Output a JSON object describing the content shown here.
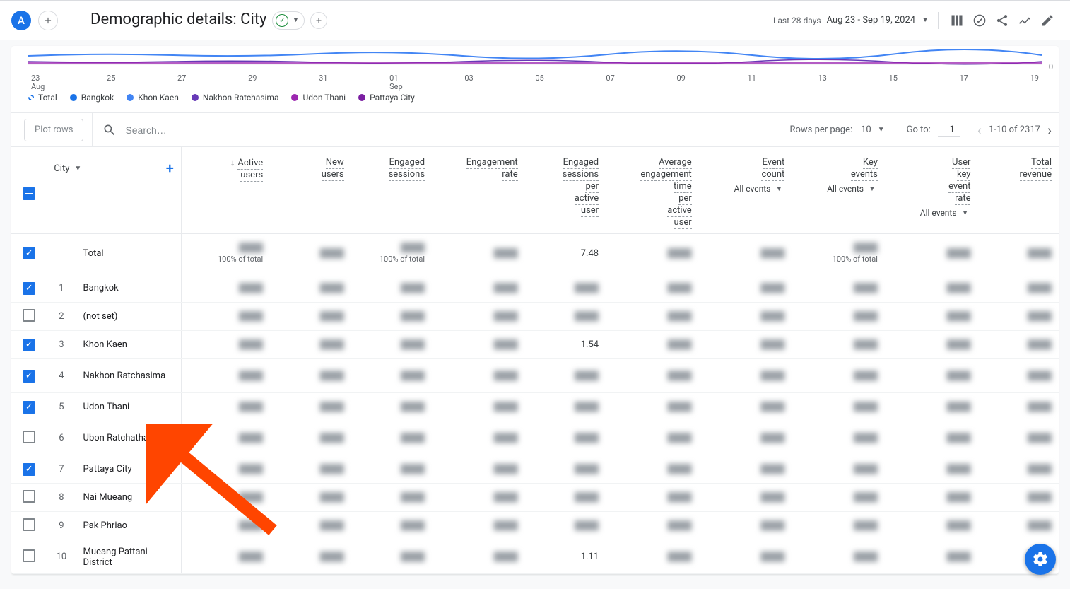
{
  "avatar_letter": "A",
  "page_title": "Demographic details: City",
  "date_label": "Last 28 days",
  "date_range": "Aug 23 - Sep 19, 2024",
  "chart": {
    "y_zero": "0",
    "x_ticks": [
      "23\nAug",
      "25",
      "27",
      "29",
      "31",
      "01\nSep",
      "03",
      "05",
      "07",
      "09",
      "11",
      "13",
      "15",
      "17",
      "19"
    ]
  },
  "legend": [
    {
      "label": "Total",
      "color": "hollow"
    },
    {
      "label": "Bangkok",
      "color": "#1a73e8"
    },
    {
      "label": "Khon Kaen",
      "color": "#4285f4"
    },
    {
      "label": "Nakhon Ratchasima",
      "color": "#673ab7"
    },
    {
      "label": "Udon Thani",
      "color": "#9c27b0"
    },
    {
      "label": "Pattaya City",
      "color": "#7b1fa2"
    }
  ],
  "controls": {
    "plot_rows": "Plot rows",
    "search_placeholder": "Search…",
    "rows_per_page_label": "Rows per page:",
    "rows_per_page_value": "10",
    "go_to_label": "Go to:",
    "go_to_value": "1",
    "range_text": "1-10 of 2317"
  },
  "columns": {
    "dim_label": "City",
    "metrics": [
      {
        "label": "Active users",
        "sort": true
      },
      {
        "label": "New users"
      },
      {
        "label": "Engaged sessions"
      },
      {
        "label": "Engagement rate"
      },
      {
        "label": "Engaged sessions per active user"
      },
      {
        "label": "Average engagement time per active user"
      },
      {
        "label": "Event count",
        "sub": "All events"
      },
      {
        "label": "Key events",
        "sub": "All events"
      },
      {
        "label": "User key event rate",
        "sub": "All events"
      },
      {
        "label": "Total revenue"
      }
    ]
  },
  "total_row": {
    "label": "Total",
    "subs": [
      "100% of total",
      "",
      "100% of total",
      "",
      "",
      "",
      "",
      "100% of total",
      "",
      ""
    ],
    "clear_vals": [
      "",
      "",
      "",
      "",
      "7.48",
      "",
      "",
      "",
      "",
      ""
    ]
  },
  "rows": [
    {
      "rank": "1",
      "name": "Bangkok",
      "checked": true,
      "clear": {}
    },
    {
      "rank": "2",
      "name": "(not set)",
      "checked": false,
      "clear": {}
    },
    {
      "rank": "3",
      "name": "Khon Kaen",
      "checked": true,
      "clear": {
        "4": "1.54"
      }
    },
    {
      "rank": "4",
      "name": "Nakhon Ratchasima",
      "checked": true,
      "clear": {}
    },
    {
      "rank": "5",
      "name": "Udon Thani",
      "checked": true,
      "clear": {}
    },
    {
      "rank": "6",
      "name": "Ubon Ratchathani",
      "checked": false,
      "clear": {}
    },
    {
      "rank": "7",
      "name": "Pattaya City",
      "checked": true,
      "clear": {}
    },
    {
      "rank": "8",
      "name": "Nai Mueang",
      "checked": false,
      "clear": {}
    },
    {
      "rank": "9",
      "name": "Pak Phriao",
      "checked": false,
      "clear": {}
    },
    {
      "rank": "10",
      "name": "Mueang Pattani District",
      "checked": false,
      "clear": {
        "4": "1.11"
      }
    }
  ],
  "blur_placeholder": "████"
}
